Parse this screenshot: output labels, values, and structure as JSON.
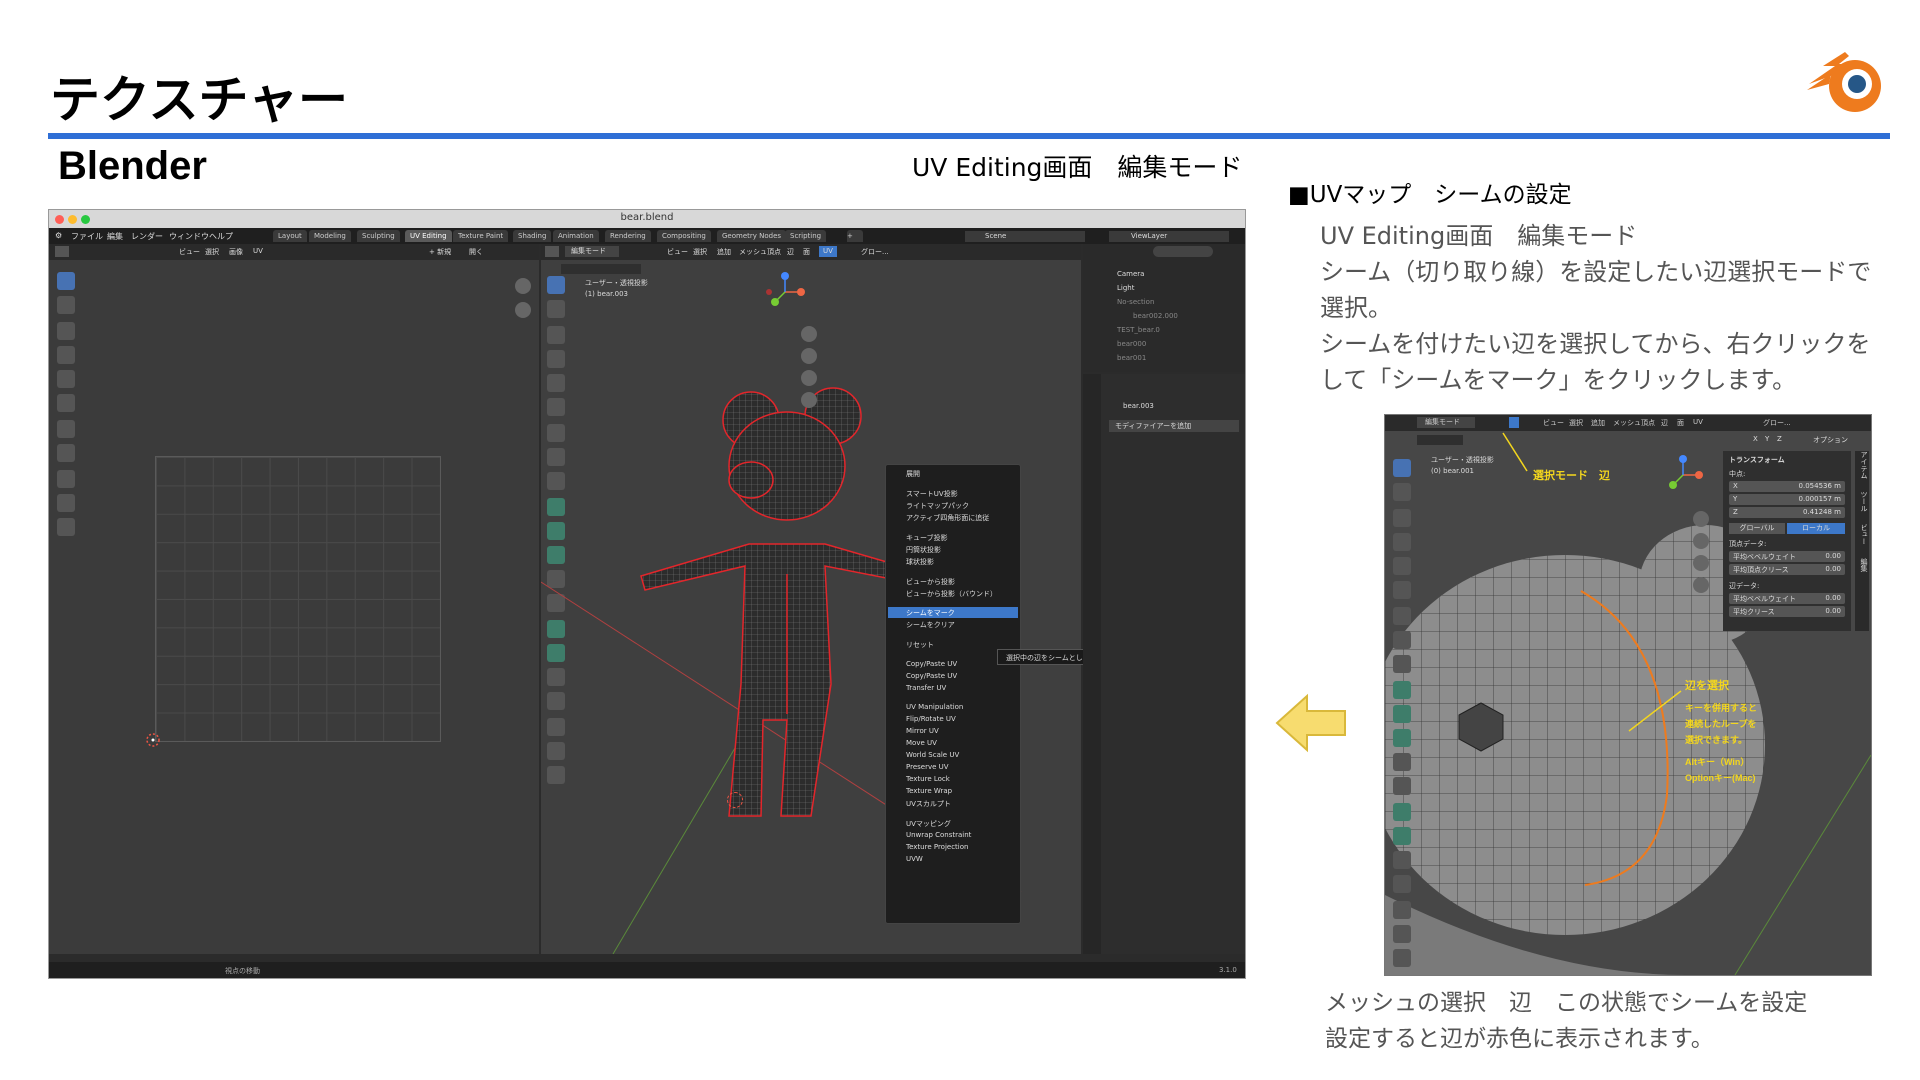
{
  "slide": {
    "title": "テクスチャー",
    "subtitle": "Blender",
    "center_caption": "UV Editing画面　編集モード",
    "right_heading": "■UVマップ　シームの設定",
    "right_lines": [
      "UV Editing画面　編集モード",
      "シーム（切り取り線）を設定したい辺選択モードで",
      "選択。",
      "シームを付けたい辺を選択してから、右クリックを",
      "して「シームをマーク」をクリックします。"
    ],
    "bottom_lines": [
      "メッシュの選択　辺　この状態でシームを設定",
      "設定すると辺が赤色に表示されます。"
    ]
  },
  "colors": {
    "rule": "#2f6fd6",
    "logo_orange": "#ee7b1e",
    "logo_blue": "#265787",
    "arrow": "#f7dc6f",
    "highlight": "#3d78c9",
    "seam": "#e3262b"
  },
  "icons": {
    "logo": "blender-logo-icon",
    "arrow": "arrow-left-icon"
  },
  "blender": {
    "window_title": "bear.blend",
    "menu": [
      "ファイル",
      "編集",
      "レンダー",
      "ウィンドウ",
      "ヘルプ"
    ],
    "workspaces": [
      "Layout",
      "Modeling",
      "Sculpting",
      "UV Editing",
      "Texture Paint",
      "Shading",
      "Animation",
      "Rendering",
      "Compositing",
      "Geometry Nodes",
      "Scripting"
    ],
    "scene": "Scene",
    "view_layer": "ViewLayer",
    "uv_header": [
      "ビュー",
      "選択",
      "画像",
      "UV"
    ],
    "uv_new": "+ 新規",
    "uv_open": "開く",
    "vp_mode": "編集モード",
    "vp_header": [
      "ビュー",
      "選択",
      "追加",
      "メッシュ",
      "頂点",
      "辺",
      "面",
      "UV"
    ],
    "vp_global": "グロー...",
    "vp_info_1": "ユーザー・透視投影",
    "vp_info_2": "(1) bear.003",
    "uv_menu": [
      "展開",
      "スマートUV投影",
      "ライトマップパック",
      "アクティブ四角形面に追従",
      "キューブ投影",
      "円筒状投影",
      "球状投影",
      "ビューから投影",
      "ビューから投影（バウンド）",
      "シームをマーク",
      "シームをクリア",
      "リセット",
      "Copy/Paste UV",
      "Copy/Paste UV",
      "Transfer UV",
      "UV Manipulation",
      "Flip/Rotate UV",
      "Mirror UV",
      "Move UV",
      "World Scale UV",
      "Preserve UV",
      "Texture Lock",
      "Texture Wrap",
      "UVスカルプト",
      "UVマッピング",
      "Unwrap Constraint",
      "Texture Projection",
      "UVW"
    ],
    "tooltip": "選択中の辺をシームとしてマーク(解除)します。",
    "outliner": [
      "Camera",
      "Light",
      "No-section",
      "bear002.000",
      "TEST_bear.0",
      "bear000",
      "bear001"
    ],
    "props_object": "bear.003",
    "props_modifier": "モディファイアーを追加",
    "status_text": "視点の移動",
    "version": "3.1.0"
  },
  "zoom": {
    "mode": "編集モード",
    "header": [
      "ビュー",
      "選択",
      "追加",
      "メッシュ",
      "頂点",
      "辺",
      "面",
      "UV"
    ],
    "global": "グロー...",
    "options": "オプション",
    "axes": [
      "X",
      "Y",
      "Z"
    ],
    "info_1": "ユーザー・透視投影",
    "info_2": "(0) bear.001",
    "transform_title": "トランスフォーム",
    "median_label": "中点:",
    "fields": [
      {
        "axis": "X",
        "value": "0.054536 m"
      },
      {
        "axis": "Y",
        "value": "0.000157 m"
      },
      {
        "axis": "Z",
        "value": "0.41248 m"
      }
    ],
    "global_btn": "グローバル",
    "local_btn": "ローカル",
    "vertex_data": "頂点データ:",
    "vertex_fields": [
      {
        "label": "平均ベベルウェイト",
        "value": "0.00"
      },
      {
        "label": "平均頂点クリース",
        "value": "0.00"
      }
    ],
    "edge_data": "辺データ:",
    "edge_fields": [
      {
        "label": "平均ベベルウェイト",
        "value": "0.00"
      },
      {
        "label": "平均クリース",
        "value": "0.00"
      }
    ],
    "side_tabs": [
      "アイテム",
      "ツール",
      "ビュー",
      "編集"
    ],
    "annot_select_mode": "選択モード　辺",
    "annot_title": "辺を選択",
    "annot_lines": [
      "キーを併用すると",
      "連続したループを",
      "選択できます。"
    ],
    "annot_alt": "Altキー（Win）",
    "annot_option": "Optionキー(Mac)"
  }
}
